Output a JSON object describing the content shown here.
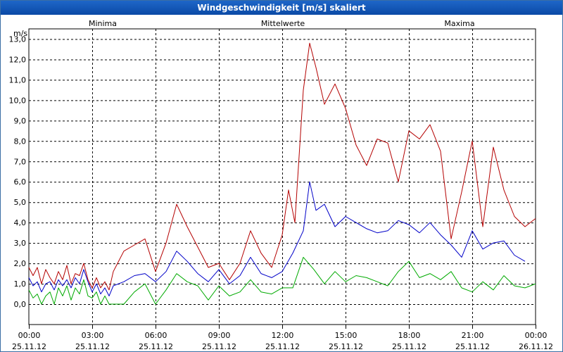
{
  "window_title": "Windgeschwindigkeit [m/s] skaliert",
  "chart_data": {
    "type": "line",
    "title": "Windgeschwindigkeit [m/s] skaliert",
    "ylabel": "m/s",
    "ylim": [
      -1.0,
      13.5
    ],
    "y_ticks": [
      "13,0",
      "12,0",
      "11,0",
      "10,0",
      "9,0",
      "8,0",
      "7,0",
      "6,0",
      "5,0",
      "4,0",
      "3,0",
      "2,0",
      "1,0",
      "0,0"
    ],
    "y_tick_values": [
      13,
      12,
      11,
      10,
      9,
      8,
      7,
      6,
      5,
      4,
      3,
      2,
      1,
      0
    ],
    "x_range_hours": [
      0,
      24
    ],
    "x_ticks": [
      {
        "time": "00:00",
        "date": "25.11.12"
      },
      {
        "time": "03:00",
        "date": "25.11.12"
      },
      {
        "time": "06:00",
        "date": "25.11.12"
      },
      {
        "time": "09:00",
        "date": "25.11.12"
      },
      {
        "time": "12:00",
        "date": "25.11.12"
      },
      {
        "time": "15:00",
        "date": "25.11.12"
      },
      {
        "time": "18:00",
        "date": "25.11.12"
      },
      {
        "time": "21:00",
        "date": "25.11.12"
      },
      {
        "time": "00:00",
        "date": "26.11.12"
      }
    ],
    "grid": true,
    "series": [
      {
        "name": "Minima",
        "color": "#00aa00",
        "hours": [
          0,
          0.2,
          0.4,
          0.6,
          0.8,
          1.0,
          1.2,
          1.4,
          1.6,
          1.8,
          2.0,
          2.2,
          2.4,
          2.6,
          2.8,
          3.0,
          3.2,
          3.4,
          3.6,
          3.8,
          4.0,
          4.5,
          5.0,
          5.5,
          6.0,
          6.5,
          7.0,
          7.5,
          8.0,
          8.5,
          9.0,
          9.5,
          10.0,
          10.5,
          11.0,
          11.5,
          12.0,
          12.5,
          13.0,
          13.5,
          14.0,
          14.5,
          15.0,
          15.5,
          16.0,
          16.5,
          17.0,
          17.5,
          18.0,
          18.5,
          19.0,
          19.5,
          20.0,
          20.5,
          21.0,
          21.5,
          22.0,
          22.5,
          23.0,
          23.5,
          24.0
        ],
        "values": [
          0.7,
          0.3,
          0.5,
          0.0,
          0.4,
          0.6,
          0.0,
          0.8,
          0.4,
          0.9,
          0.2,
          0.8,
          0.5,
          1.2,
          0.4,
          0.3,
          0.6,
          0.0,
          0.4,
          0.0,
          0.0,
          0.0,
          0.6,
          1.0,
          0.0,
          0.7,
          1.5,
          1.1,
          0.9,
          0.2,
          0.9,
          0.4,
          0.6,
          1.2,
          0.6,
          0.5,
          0.8,
          0.8,
          2.3,
          1.7,
          1.0,
          1.6,
          1.1,
          1.4,
          1.3,
          1.1,
          0.9,
          1.6,
          2.1,
          1.3,
          1.5,
          1.2,
          1.6,
          0.8,
          0.6,
          1.1,
          0.7,
          1.4,
          0.9,
          0.8,
          1.0
        ]
      },
      {
        "name": "Mittelwerte",
        "color": "#0000c8",
        "hours": [
          0,
          0.2,
          0.4,
          0.6,
          0.8,
          1.0,
          1.2,
          1.4,
          1.6,
          1.8,
          2.0,
          2.2,
          2.4,
          2.6,
          2.8,
          3.0,
          3.2,
          3.4,
          3.6,
          3.8,
          4.0,
          4.5,
          5.0,
          5.5,
          6.0,
          6.5,
          7.0,
          7.5,
          8.0,
          8.5,
          9.0,
          9.5,
          10.0,
          10.5,
          11.0,
          11.5,
          12.0,
          12.5,
          13.0,
          13.3,
          13.6,
          14.0,
          14.5,
          15.0,
          15.5,
          16.0,
          16.5,
          17.0,
          17.5,
          18.0,
          18.5,
          19.0,
          19.5,
          20.0,
          20.5,
          21.0,
          21.5,
          22.0,
          22.5,
          23.0,
          23.5,
          24.0
        ],
        "values": [
          1.3,
          0.9,
          1.1,
          0.6,
          1.0,
          1.1,
          0.7,
          1.2,
          0.9,
          1.2,
          0.8,
          1.3,
          1.0,
          1.7,
          1.1,
          0.6,
          1.0,
          0.5,
          0.8,
          0.4,
          0.9,
          1.1,
          1.4,
          1.5,
          1.1,
          1.6,
          2.6,
          2.1,
          1.5,
          1.1,
          1.7,
          1.0,
          1.4,
          2.3,
          1.5,
          1.3,
          1.6,
          2.5,
          3.6,
          6.0,
          4.6,
          4.9,
          3.8,
          4.3,
          4.0,
          3.7,
          3.5,
          3.6,
          4.1,
          3.9,
          3.5,
          4.0,
          3.4,
          2.9,
          2.3,
          3.6,
          2.7,
          3.0,
          3.1,
          2.4,
          2.1
        ]
      },
      {
        "name": "Maxima",
        "color": "#b40000",
        "hours": [
          0,
          0.2,
          0.4,
          0.6,
          0.8,
          1.0,
          1.2,
          1.4,
          1.6,
          1.8,
          2.0,
          2.2,
          2.4,
          2.6,
          2.8,
          3.0,
          3.2,
          3.4,
          3.6,
          3.8,
          4.0,
          4.5,
          5.0,
          5.5,
          6.0,
          6.5,
          7.0,
          7.5,
          8.0,
          8.5,
          9.0,
          9.5,
          10.0,
          10.5,
          11.0,
          11.5,
          12.0,
          12.3,
          12.6,
          13.0,
          13.3,
          13.6,
          14.0,
          14.5,
          15.0,
          15.5,
          16.0,
          16.5,
          17.0,
          17.5,
          18.0,
          18.5,
          19.0,
          19.5,
          20.0,
          20.5,
          21.0,
          21.5,
          22.0,
          22.5,
          23.0,
          23.5,
          24.0
        ],
        "values": [
          1.8,
          1.4,
          1.8,
          1.0,
          1.7,
          1.3,
          1.0,
          1.6,
          1.2,
          1.9,
          1.0,
          1.5,
          1.4,
          2.0,
          1.2,
          0.8,
          1.3,
          0.8,
          1.1,
          0.7,
          1.6,
          2.6,
          2.9,
          3.2,
          1.6,
          3.0,
          4.9,
          3.8,
          2.8,
          1.8,
          2.0,
          1.2,
          2.0,
          3.6,
          2.5,
          1.8,
          3.4,
          5.6,
          4.0,
          10.5,
          12.8,
          11.6,
          9.8,
          10.8,
          9.6,
          7.8,
          6.8,
          8.1,
          7.9,
          6.0,
          8.5,
          8.1,
          8.8,
          7.5,
          3.2,
          5.5,
          8.0,
          3.8,
          7.7,
          5.6,
          4.3,
          3.8,
          4.2
        ]
      }
    ]
  }
}
